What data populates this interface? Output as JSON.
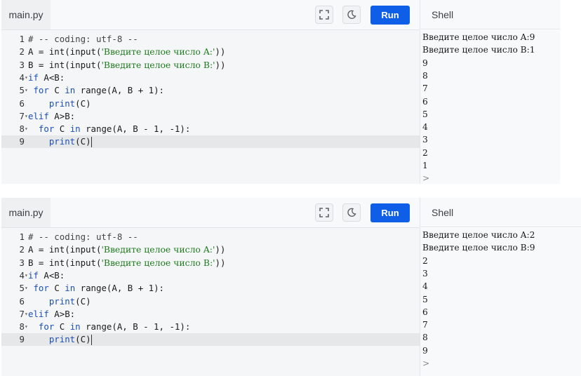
{
  "panels": [
    {
      "tab": "main.py",
      "run_label": "Run",
      "shell_title": "Shell",
      "code": [
        {
          "n": "1",
          "fold": "",
          "parts": [
            {
              "c": "cm",
              "t": "# -- coding: utf-8 --"
            }
          ]
        },
        {
          "n": "2",
          "fold": "",
          "parts": [
            {
              "c": "",
              "t": "A = int(input("
            },
            {
              "c": "str",
              "t": "'Введите целое число A:'"
            },
            {
              "c": "",
              "t": "))"
            }
          ]
        },
        {
          "n": "3",
          "fold": "",
          "parts": [
            {
              "c": "",
              "t": "B = int(input("
            },
            {
              "c": "str",
              "t": "'Введите целое число B:'"
            },
            {
              "c": "",
              "t": "))"
            }
          ]
        },
        {
          "n": "4",
          "fold": "▾",
          "parts": [
            {
              "c": "kw",
              "t": "if"
            },
            {
              "c": "",
              "t": " A<B:"
            }
          ]
        },
        {
          "n": "5",
          "fold": "▾",
          "parts": [
            {
              "c": "",
              "t": " "
            },
            {
              "c": "kw",
              "t": "for"
            },
            {
              "c": "",
              "t": " C "
            },
            {
              "c": "kw",
              "t": "in"
            },
            {
              "c": "",
              "t": " range(A, B + 1):"
            }
          ]
        },
        {
          "n": "6",
          "fold": "",
          "parts": [
            {
              "c": "",
              "t": "    "
            },
            {
              "c": "kw",
              "t": "print"
            },
            {
              "c": "",
              "t": "(C)"
            }
          ]
        },
        {
          "n": "7",
          "fold": "▾",
          "parts": [
            {
              "c": "kw",
              "t": "elif"
            },
            {
              "c": "",
              "t": " A>B:"
            }
          ]
        },
        {
          "n": "8",
          "fold": "▾",
          "parts": [
            {
              "c": "",
              "t": "  "
            },
            {
              "c": "kw",
              "t": "for"
            },
            {
              "c": "",
              "t": " C "
            },
            {
              "c": "kw",
              "t": "in"
            },
            {
              "c": "",
              "t": " range(A, B - 1, -1):"
            }
          ]
        },
        {
          "n": "9",
          "fold": "",
          "active": true,
          "parts": [
            {
              "c": "",
              "t": "    "
            },
            {
              "c": "kw",
              "t": "print"
            },
            {
              "c": "",
              "t": "(C)"
            }
          ]
        }
      ],
      "shell": [
        "Введите целое число A:9",
        "Введите целое число B:1",
        "9",
        "8",
        "7",
        "6",
        "5",
        "4",
        "3",
        "2",
        "1"
      ],
      "prompt": ">"
    },
    {
      "tab": "main.py",
      "run_label": "Run",
      "shell_title": "Shell",
      "code": [
        {
          "n": "1",
          "fold": "",
          "parts": [
            {
              "c": "cm",
              "t": "# -- coding: utf-8 --"
            }
          ]
        },
        {
          "n": "2",
          "fold": "",
          "parts": [
            {
              "c": "",
              "t": "A = int(input("
            },
            {
              "c": "str",
              "t": "'Введите целое число A:'"
            },
            {
              "c": "",
              "t": "))"
            }
          ]
        },
        {
          "n": "3",
          "fold": "",
          "parts": [
            {
              "c": "",
              "t": "B = int(input("
            },
            {
              "c": "str",
              "t": "'Введите целое число B:'"
            },
            {
              "c": "",
              "t": "))"
            }
          ]
        },
        {
          "n": "4",
          "fold": "▾",
          "parts": [
            {
              "c": "kw",
              "t": "if"
            },
            {
              "c": "",
              "t": " A<B:"
            }
          ]
        },
        {
          "n": "5",
          "fold": "▾",
          "parts": [
            {
              "c": "",
              "t": " "
            },
            {
              "c": "kw",
              "t": "for"
            },
            {
              "c": "",
              "t": " C "
            },
            {
              "c": "kw",
              "t": "in"
            },
            {
              "c": "",
              "t": " range(A, B + 1):"
            }
          ]
        },
        {
          "n": "6",
          "fold": "",
          "parts": [
            {
              "c": "",
              "t": "    "
            },
            {
              "c": "kw",
              "t": "print"
            },
            {
              "c": "",
              "t": "(C)"
            }
          ]
        },
        {
          "n": "7",
          "fold": "▾",
          "parts": [
            {
              "c": "kw",
              "t": "elif"
            },
            {
              "c": "",
              "t": " A>B:"
            }
          ]
        },
        {
          "n": "8",
          "fold": "▾",
          "parts": [
            {
              "c": "",
              "t": "  "
            },
            {
              "c": "kw",
              "t": "for"
            },
            {
              "c": "",
              "t": " C "
            },
            {
              "c": "kw",
              "t": "in"
            },
            {
              "c": "",
              "t": " range(A, B - 1, -1):"
            }
          ]
        },
        {
          "n": "9",
          "fold": "",
          "active": true,
          "parts": [
            {
              "c": "",
              "t": "    "
            },
            {
              "c": "kw",
              "t": "print"
            },
            {
              "c": "",
              "t": "(C)"
            }
          ]
        }
      ],
      "shell": [
        "Введите целое число A:2",
        "Введите целое число B:9",
        "2",
        "3",
        "4",
        "5",
        "6",
        "7",
        "8",
        "9"
      ],
      "prompt": ">"
    }
  ],
  "icons": {
    "fullscreen": "fullscreen-icon",
    "theme": "moon-icon"
  },
  "colors": {
    "run": "#0e5ee8",
    "editor_bg": "#f5f6f7",
    "keyword": "#1a4fb8",
    "string": "#1e7a1e"
  }
}
